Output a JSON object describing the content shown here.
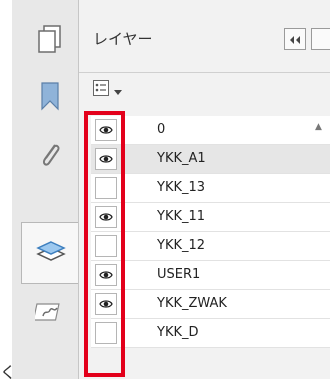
{
  "left_edge_char": "く",
  "panel": {
    "title": "レイヤー"
  },
  "rail": {
    "items": [
      {
        "name": "page-thumbnails",
        "icon": "pages-icon"
      },
      {
        "name": "bookmarks",
        "icon": "bookmark-icon"
      },
      {
        "name": "attachments",
        "icon": "paperclip-icon"
      },
      {
        "name": "layers",
        "icon": "layers-icon",
        "active": true
      },
      {
        "name": "signatures",
        "icon": "signature-icon"
      }
    ]
  },
  "layers": [
    {
      "name": "0",
      "visible": true,
      "selected": false
    },
    {
      "name": "YKK_A1",
      "visible": true,
      "selected": true
    },
    {
      "name": "YKK_13",
      "visible": false,
      "selected": false
    },
    {
      "name": "YKK_11",
      "visible": true,
      "selected": false
    },
    {
      "name": "YKK_12",
      "visible": false,
      "selected": false
    },
    {
      "name": "USER1",
      "visible": true,
      "selected": false
    },
    {
      "name": "YKK_ZWAK",
      "visible": true,
      "selected": false
    },
    {
      "name": "YKK_D",
      "visible": false,
      "selected": false
    }
  ],
  "colors": {
    "highlight": "#e3001b"
  }
}
